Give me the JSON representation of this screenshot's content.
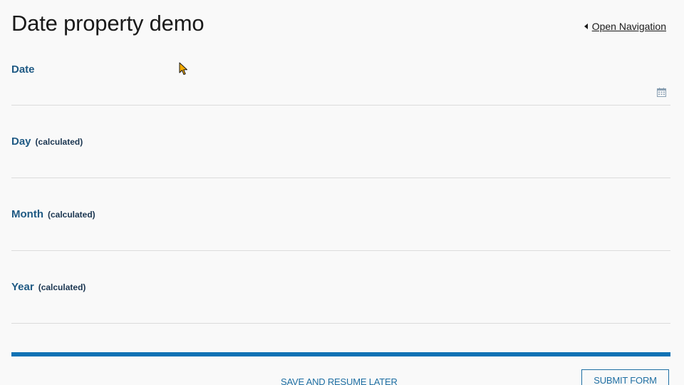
{
  "header": {
    "title": "Date property demo",
    "nav_link": "Open Navigation"
  },
  "fields": [
    {
      "label": "Date",
      "note": "",
      "value": ""
    },
    {
      "label": "Day",
      "note": "(calculated)",
      "value": ""
    },
    {
      "label": "Month",
      "note": "(calculated)",
      "value": ""
    },
    {
      "label": "Year",
      "note": "(calculated)",
      "value": ""
    }
  ],
  "footer": {
    "save_label": "SAVE AND RESUME LATER",
    "submit_label": "SUBMIT FORM"
  },
  "colors": {
    "accent": "#0f72b5",
    "label": "#1f5a84",
    "background": "#f9f9f9"
  },
  "icons": {
    "date_picker": "calendar-icon",
    "nav": "caret-left-icon",
    "pointer": "mouse-cursor-icon"
  }
}
